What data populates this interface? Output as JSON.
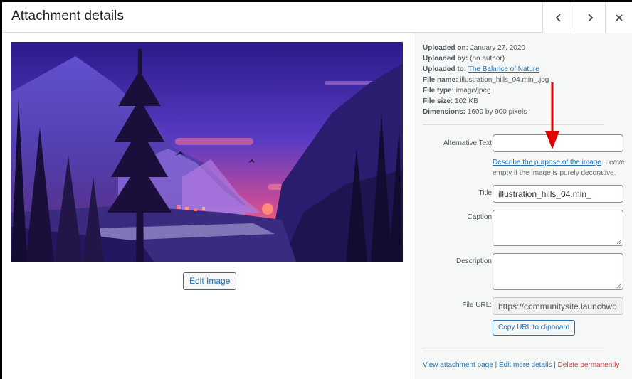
{
  "header": {
    "title": "Attachment details",
    "prev_icon": "chevron-left-icon",
    "next_icon": "chevron-right-icon",
    "close_icon": "close-icon"
  },
  "main": {
    "edit_image_label": "Edit Image"
  },
  "details": {
    "uploaded_on_label": "Uploaded on:",
    "uploaded_on_value": "January 27, 2020",
    "uploaded_by_label": "Uploaded by:",
    "uploaded_by_value": "(no author)",
    "uploaded_to_label": "Uploaded to:",
    "uploaded_to_value": "The Balance of Nature",
    "file_name_label": "File name:",
    "file_name_value": "illustration_hills_04.min_.jpg",
    "file_type_label": "File type:",
    "file_type_value": "image/jpeg",
    "file_size_label": "File size:",
    "file_size_value": "102 KB",
    "dimensions_label": "Dimensions:",
    "dimensions_value": "1600 by 900 pixels"
  },
  "form": {
    "alt_text_label": "Alternative Text",
    "alt_text_value": "",
    "alt_help_link": "Describe the purpose of the image",
    "alt_help_rest": ". Leave empty if the image is purely decorative.",
    "title_label": "Title",
    "title_value": "illustration_hills_04.min_",
    "caption_label": "Caption",
    "caption_value": "",
    "description_label": "Description",
    "description_value": "",
    "file_url_label": "File URL:",
    "file_url_value": "https://communitysite.launchwp.",
    "copy_url_label": "Copy URL to clipboard"
  },
  "actions": {
    "view_label": "View attachment page",
    "sep": " | ",
    "edit_label": "Edit more details",
    "delete_label": "Delete permanently"
  },
  "colors": {
    "link": "#2271b1",
    "danger": "#d63638",
    "annotation_arrow": "#e00000"
  }
}
